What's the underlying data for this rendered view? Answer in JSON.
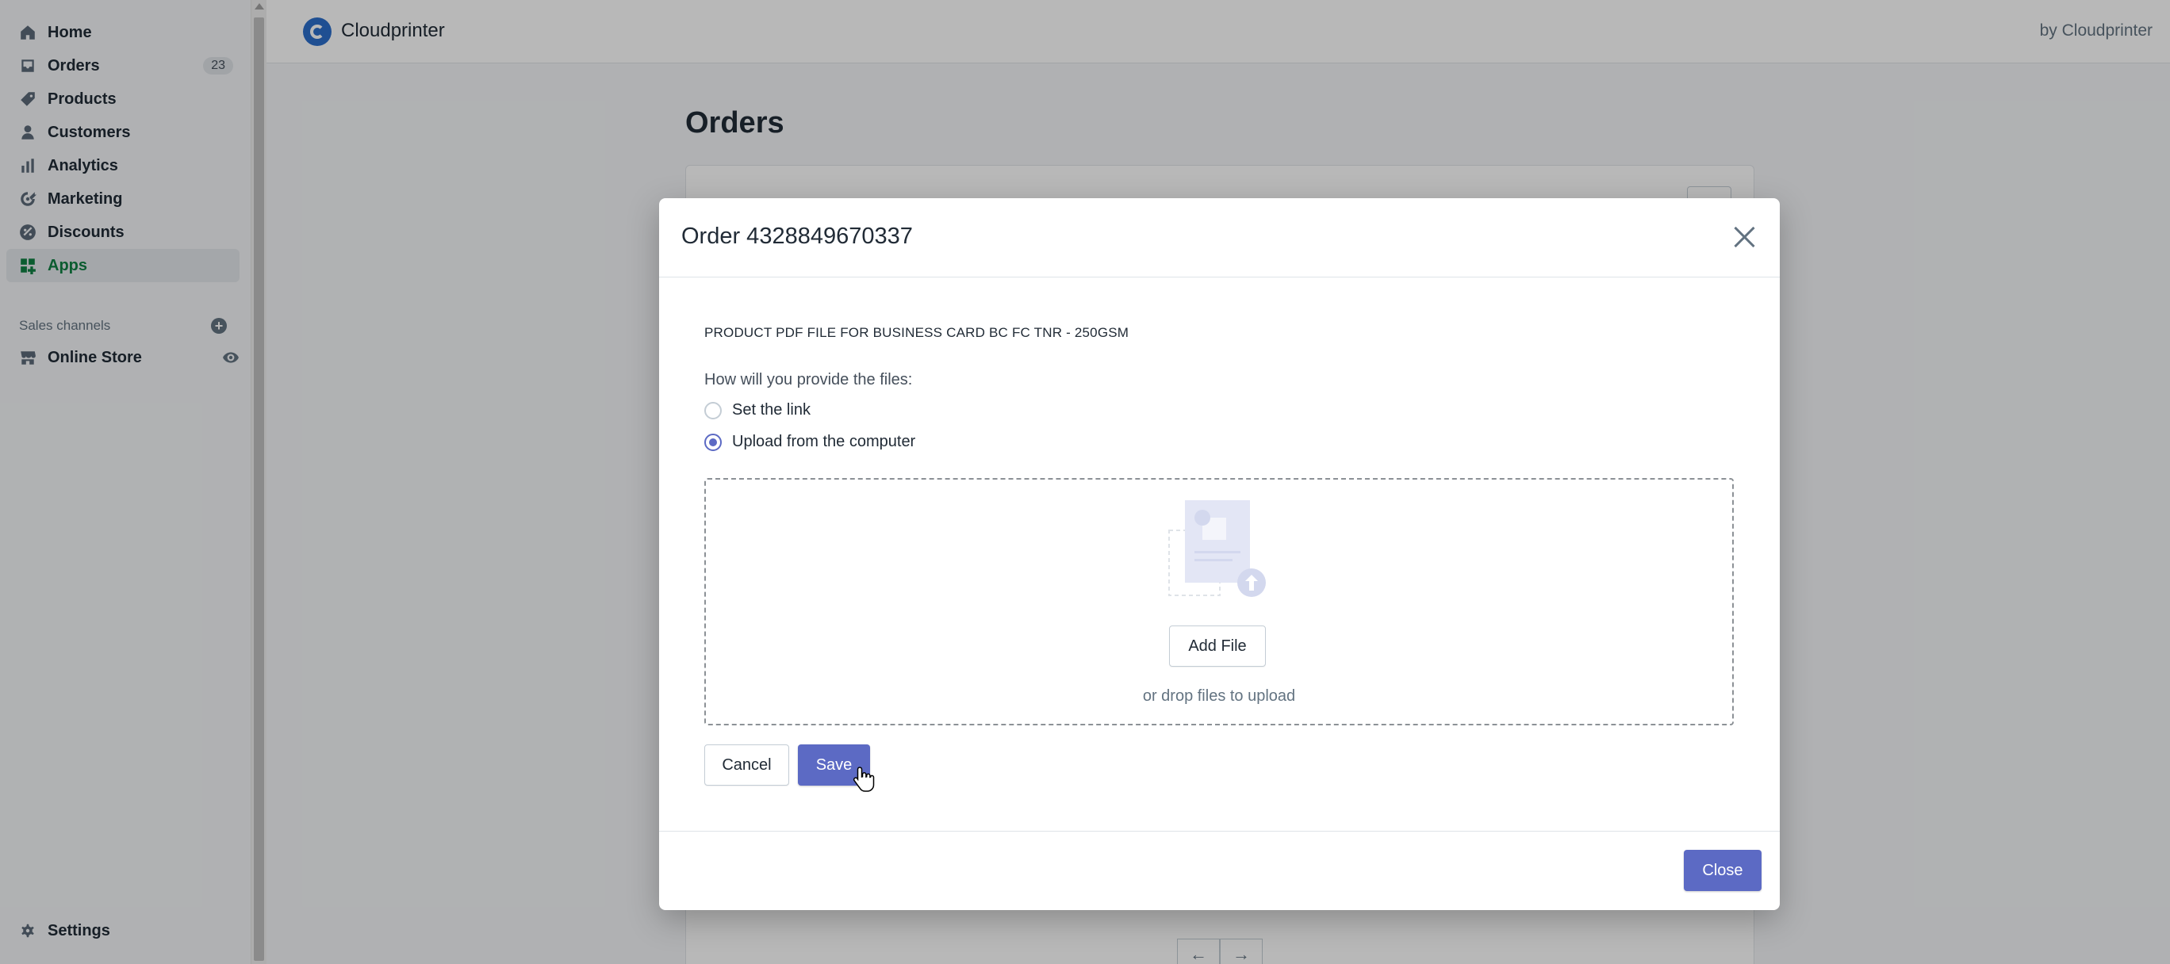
{
  "sidebar": {
    "items": [
      {
        "label": "Home",
        "icon": "home-icon"
      },
      {
        "label": "Orders",
        "icon": "orders-icon",
        "badge": "23"
      },
      {
        "label": "Products",
        "icon": "tag-icon"
      },
      {
        "label": "Customers",
        "icon": "person-icon"
      },
      {
        "label": "Analytics",
        "icon": "bar-chart-icon"
      },
      {
        "label": "Marketing",
        "icon": "target-icon"
      },
      {
        "label": "Discounts",
        "icon": "discount-icon"
      },
      {
        "label": "Apps",
        "icon": "apps-icon",
        "active": true
      }
    ],
    "sales_channels_heading": "Sales channels",
    "online_store_label": "Online Store",
    "settings_label": "Settings"
  },
  "app_header": {
    "app_name": "Cloudprinter",
    "by": "by Cloudprinter"
  },
  "page": {
    "title": "Orders",
    "pager_prev": "←",
    "pager_next": "→"
  },
  "modal": {
    "title": "Order 4328849670337",
    "product_title": "PRODUCT PDF FILE FOR BUSINESS CARD BC FC TNR - 250GSM",
    "question": "How will you provide the files:",
    "options": [
      {
        "label": "Set the link",
        "selected": false
      },
      {
        "label": "Upload from the computer",
        "selected": true
      }
    ],
    "add_file_label": "Add File",
    "drop_hint": "or drop files to upload",
    "cancel_label": "Cancel",
    "save_label": "Save",
    "close_label": "Close"
  },
  "colors": {
    "accent": "#5c6ac4",
    "active_nav": "#108043",
    "overlay": "rgba(0,0,0,0.28)"
  }
}
